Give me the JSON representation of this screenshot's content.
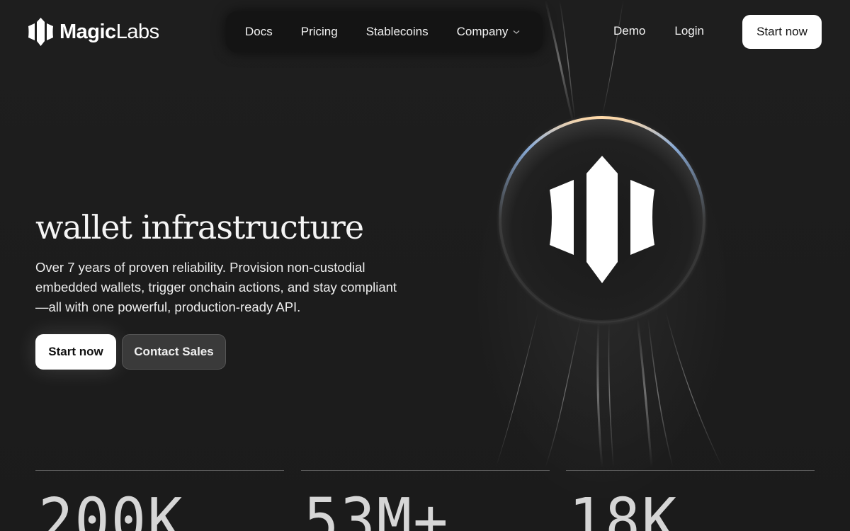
{
  "brand": {
    "name_bold": "Magic",
    "name_light": "Labs"
  },
  "nav": {
    "items": [
      {
        "label": "Docs"
      },
      {
        "label": "Pricing"
      },
      {
        "label": "Stablecoins"
      },
      {
        "label": "Company",
        "has_dropdown": true
      }
    ],
    "demo_label": "Demo",
    "login_label": "Login",
    "start_label": "Start now"
  },
  "hero": {
    "title": "wallet infrastructure",
    "description": "Over 7 years of proven reliability. Provision non-custodial embedded wallets, trigger onchain actions, and stay compliant—all with one powerful, production-ready API.",
    "primary_cta": "Start now",
    "secondary_cta": "Contact Sales"
  },
  "stats": [
    {
      "value": "200K"
    },
    {
      "value": "53M+"
    },
    {
      "value": "18K"
    }
  ],
  "colors": {
    "background": "#1c1c1c",
    "button_light": "#ffffff",
    "button_dark": "#3a3a3a"
  },
  "icons": [
    "magic-logo-icon",
    "chevron-down-icon",
    "magic-emblem-icon"
  ]
}
